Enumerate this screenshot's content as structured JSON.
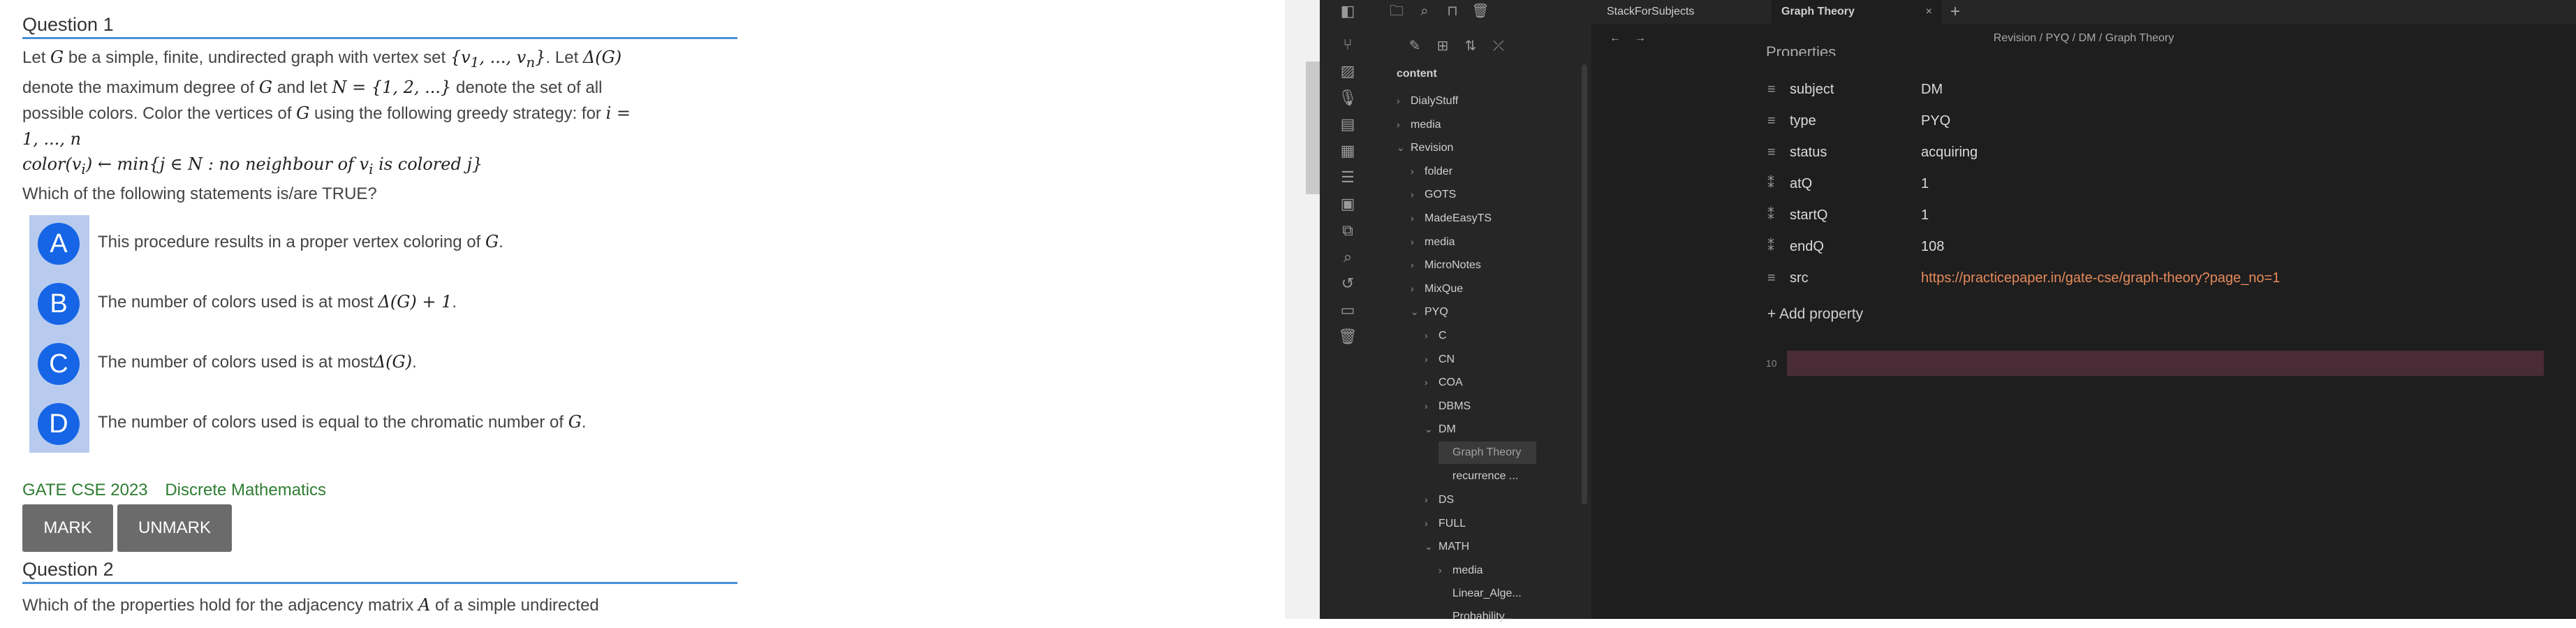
{
  "question1": {
    "heading": "Question 1",
    "line1a": "Let ",
    "G1": "G",
    "line1b": " be a simple, finite, undirected graph with vertex set ",
    "vset": "{v",
    "vsub1": "1",
    "vmid": ", ..., v",
    "vsubn": "n",
    "vend": "}",
    "line1c": ". Let ",
    "deltaG": "Δ(G)",
    "line2a": "denote the maximum degree of ",
    "G2": "G",
    "line2b": " and let ",
    "Nset": "N = {1, 2, ...}",
    "line2c": " denote the set of all",
    "line3a": "possible colors. Color the vertices of ",
    "G3": "G",
    "line3b": " using the following greedy strategy: for ",
    "ieq": "i =",
    "line4": "1, ..., n",
    "line5": "color(v",
    "line5sub": "i",
    "line5b": ") ← min{j ∈ N :  no neighbour of v",
    "line5sub2": "i",
    "line5c": " is colored j}",
    "line6": "Which of the following statements is/are TRUE?",
    "options": [
      {
        "letter": "A",
        "text": "This procedure results in a proper vertex coloring of ",
        "math": "G",
        "end": "."
      },
      {
        "letter": "B",
        "text": "The number of colors used is at most ",
        "math": "Δ(G) + 1",
        "end": "."
      },
      {
        "letter": "C",
        "text": "The number of colors used is at most",
        "math": "Δ(G)",
        "end": "."
      },
      {
        "letter": "D",
        "text": "The number of colors used is equal to the chromatic number of ",
        "math": "G",
        "end": "."
      }
    ],
    "tag1": "GATE CSE 2023",
    "tag2": "Discrete Mathematics",
    "mark_label": "MARK",
    "unmark_label": "UNMARK"
  },
  "question2": {
    "heading": "Question 2",
    "text": "Which of the properties hold for the adjacency matrix ",
    "math": "A",
    "text2": " of a simple undirected"
  },
  "app": {
    "tabs": [
      {
        "label": "StackForSubjects"
      },
      {
        "label": "Graph Theory",
        "close": "×"
      }
    ],
    "new_tab": "+",
    "breadcrumb": "Revision / PYQ / DM / Graph Theory",
    "nav_back": "←",
    "nav_forward": "→",
    "vault_root": "content",
    "tree": [
      {
        "label": "DialyStuff",
        "chev": "›",
        "depth": 0
      },
      {
        "label": "media",
        "chev": "›",
        "depth": 0
      },
      {
        "label": "Revision",
        "chev": "⌄",
        "depth": 0
      },
      {
        "label": "folder",
        "chev": "›",
        "depth": 1
      },
      {
        "label": "GOTS",
        "chev": "›",
        "depth": 1
      },
      {
        "label": "MadeEasyTS",
        "chev": "›",
        "depth": 1
      },
      {
        "label": "media",
        "chev": "›",
        "depth": 1
      },
      {
        "label": "MicroNotes",
        "chev": "›",
        "depth": 1
      },
      {
        "label": "MixQue",
        "chev": "›",
        "depth": 1
      },
      {
        "label": "PYQ",
        "chev": "⌄",
        "depth": 1
      },
      {
        "label": "C",
        "chev": "›",
        "depth": 2
      },
      {
        "label": "CN",
        "chev": "›",
        "depth": 2
      },
      {
        "label": "COA",
        "chev": "›",
        "depth": 2
      },
      {
        "label": "DBMS",
        "chev": "›",
        "depth": 2
      },
      {
        "label": "DM",
        "chev": "⌄",
        "depth": 2
      },
      {
        "label": "Graph Theory",
        "chev": "",
        "depth": 3,
        "active": true
      },
      {
        "label": "recurrence ...",
        "chev": "",
        "depth": 3
      },
      {
        "label": "DS",
        "chev": "›",
        "depth": 2
      },
      {
        "label": "FULL",
        "chev": "›",
        "depth": 2
      },
      {
        "label": "MATH",
        "chev": "⌄",
        "depth": 2
      },
      {
        "label": "media",
        "chev": "›",
        "depth": 3
      },
      {
        "label": "Linear_Alge...",
        "chev": "",
        "depth": 3
      },
      {
        "label": "Probability...",
        "chev": "",
        "depth": 3
      }
    ],
    "properties_heading": "Properties",
    "properties": [
      {
        "icon": "≡",
        "name": "subject",
        "value": "DM"
      },
      {
        "icon": "≡",
        "name": "type",
        "value": "PYQ"
      },
      {
        "icon": "≡",
        "name": "status",
        "value": "acquiring"
      },
      {
        "icon": "⁑",
        "name": "atQ",
        "value": "1"
      },
      {
        "icon": "⁑",
        "name": "startQ",
        "value": "1"
      },
      {
        "icon": "⁑",
        "name": "endQ",
        "value": "108"
      },
      {
        "icon": "≡",
        "name": "src",
        "value": "https://practicepaper.in/gate-cse/graph-theory?page_no=1",
        "link": true
      }
    ],
    "add_property": "+ Add property",
    "line_number": "10"
  }
}
